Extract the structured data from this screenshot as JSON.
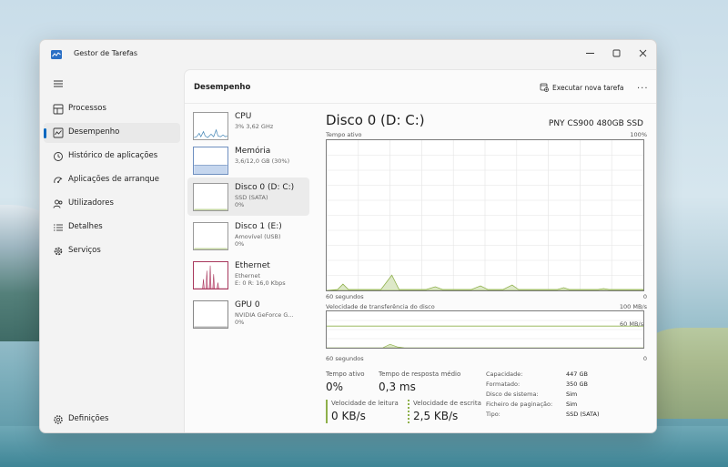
{
  "window": {
    "title": "Gestor de Tarefas"
  },
  "sidebar": {
    "items": [
      {
        "label": "Processos",
        "icon": "grid-icon"
      },
      {
        "label": "Desempenho",
        "icon": "performance-icon",
        "active": true
      },
      {
        "label": "Histórico de aplicações",
        "icon": "history-icon"
      },
      {
        "label": "Aplicações de arranque",
        "icon": "startup-icon"
      },
      {
        "label": "Utilizadores",
        "icon": "users-icon"
      },
      {
        "label": "Detalhes",
        "icon": "details-icon"
      },
      {
        "label": "Serviços",
        "icon": "services-icon"
      }
    ],
    "settings_label": "Definições"
  },
  "header": {
    "title": "Desempenho",
    "run_task": "Executar nova tarefa",
    "more": "..."
  },
  "devices": [
    {
      "name": "CPU",
      "sub": "3% 3,62 GHz",
      "val": ""
    },
    {
      "name": "Memória",
      "sub": "3,6/12,0 GB (30%)",
      "val": ""
    },
    {
      "name": "Disco 0 (D: C:)",
      "sub": "SSD (SATA)",
      "val": "0%"
    },
    {
      "name": "Disco 1 (E:)",
      "sub": "Amovível (USB)",
      "val": "0%"
    },
    {
      "name": "Ethernet",
      "sub": "Ethernet",
      "val": "E: 0 R: 16,0 Kbps"
    },
    {
      "name": "GPU 0",
      "sub": "NVIDIA GeForce G...",
      "val": "0%"
    }
  ],
  "panel": {
    "title": "Disco 0 (D: C:)",
    "model": "PNY CS900 480GB SSD",
    "graph1": {
      "label": "Tempo ativo",
      "max": "100%",
      "time": "60 segundos",
      "min": "0"
    },
    "graph2": {
      "label": "Velocidade de transferência do disco",
      "max": "100 MB/s",
      "mid": "60 MB/s",
      "time": "60 segundos",
      "min": "0"
    },
    "stats": {
      "active_time_label": "Tempo ativo",
      "active_time": "0%",
      "response_label": "Tempo de resposta médio",
      "response": "0,3 ms",
      "read_label": "Velocidade de leitura",
      "read": "0 KB/s",
      "write_label": "Velocidade de escrita",
      "write": "2,5 KB/s"
    },
    "props": [
      {
        "k": "Capacidade:",
        "v": "447 GB"
      },
      {
        "k": "Formatado:",
        "v": "350 GB"
      },
      {
        "k": "Disco de sistema:",
        "v": "Sim"
      },
      {
        "k": "Ficheiro de paginação:",
        "v": "Sim"
      },
      {
        "k": "Tipo:",
        "v": "SSD (SATA)"
      }
    ]
  },
  "colors": {
    "accent": "#0067c0",
    "disk": "#8eb04a",
    "memory": "#6e8fc0",
    "ethernet": "#a8385d"
  }
}
